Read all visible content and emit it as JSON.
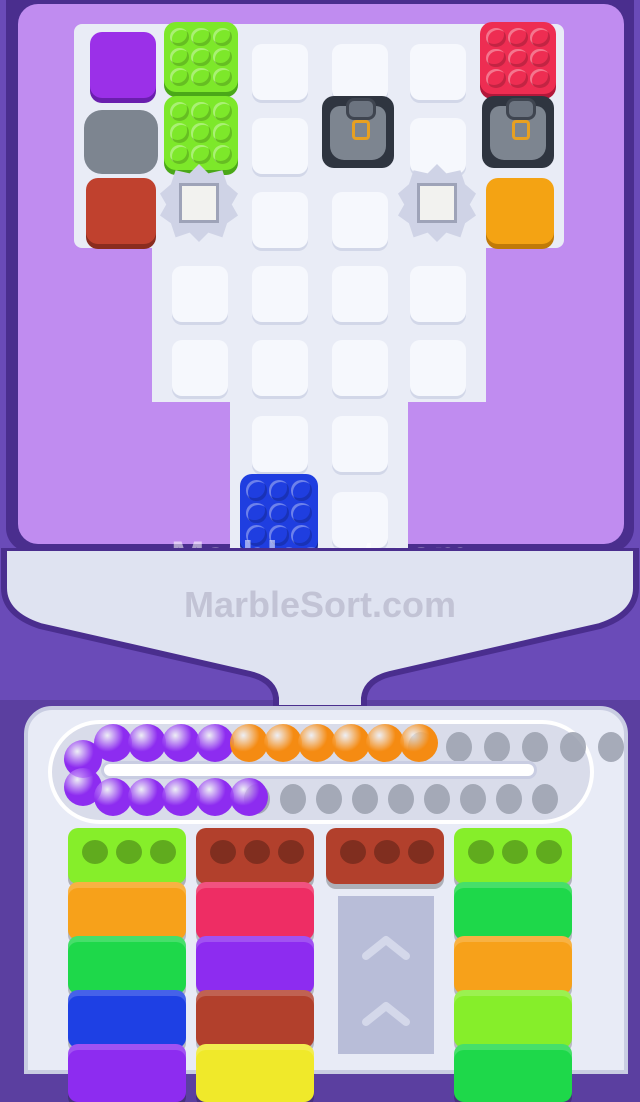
{
  "watermark": {
    "primary": "Marblesort.com",
    "secondary": "MarbleSort.com"
  },
  "board": {
    "blocks": [
      {
        "name": "purple-block",
        "color": "#9b30e8"
      },
      {
        "name": "stone-bag-left",
        "color": "#7d8590"
      },
      {
        "name": "brick-block",
        "color": "#c0412e"
      },
      {
        "name": "orange-block",
        "color": "#f4a313"
      }
    ],
    "egg_crates": [
      {
        "name": "lime-crate-top",
        "color": "#7de82a"
      },
      {
        "name": "lime-crate-mid",
        "color": "#7de82a"
      },
      {
        "name": "red-crate",
        "color": "#ee2d52"
      },
      {
        "name": "blue-crate",
        "color": "#1f3ee0"
      }
    ]
  },
  "track": {
    "upper_marbles": [
      "#8d2cf0",
      "#8d2cf0",
      "#8d2cf0",
      "#8d2cf0",
      "#8d2cf0",
      "#f58b12",
      "#f58b12",
      "#f58b12",
      "#f58b12",
      "#f58b12",
      "#f58b12"
    ],
    "lower_marbles": [
      "#8d2cf0",
      "#8d2cf0",
      "#8d2cf0",
      "#8d2cf0",
      "#8d2cf0",
      "#8d2cf0"
    ]
  },
  "bins": {
    "columns": [
      [
        "#86ee2a",
        "#f7a11a",
        "#1ed84a",
        "#1e40e4",
        "#8d2cf0"
      ],
      [
        "#b2402c",
        "#ee2d64",
        "#8d2cf0",
        "#b2402c",
        "#f0e92a"
      ],
      [
        "#b2402c"
      ],
      [
        "#86ee2a",
        "#1ed84a",
        "#f7a11a",
        "#86ee2a",
        "#1ed84a"
      ]
    ]
  },
  "colors": {
    "frame": "#4a2e8e",
    "board": "#c08cf0",
    "grid": "#e9ecf6"
  }
}
